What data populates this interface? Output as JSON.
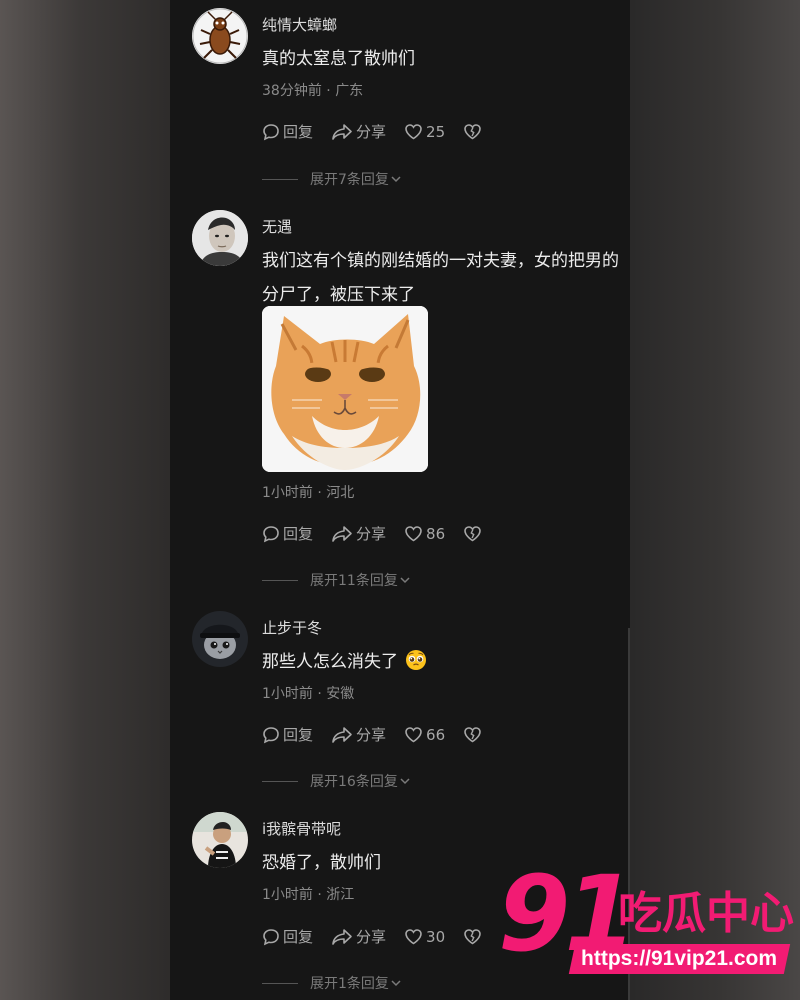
{
  "comments": [
    {
      "username": "纯情大蟑螂",
      "text": "真的太窒息了散帅们",
      "time": "38分钟前",
      "location": "广东",
      "reply": "回复",
      "share": "分享",
      "likes": "25",
      "expand": "展开7条回复"
    },
    {
      "username": "无遇",
      "text": "我们这有个镇的刚结婚的一对夫妻，女的把男的分尸了，被压下来了",
      "time": "1小时前",
      "location": "河北",
      "reply": "回复",
      "share": "分享",
      "likes": "86",
      "expand": "展开11条回复"
    },
    {
      "username": "止步于冬",
      "text": "那些人怎么消失了",
      "time": "1小时前",
      "location": "安徽",
      "reply": "回复",
      "share": "分享",
      "likes": "66",
      "expand": "展开16条回复"
    },
    {
      "username": "i我髌骨带呢",
      "text": "恐婚了，散帅们",
      "time": "1小时前",
      "location": "浙江",
      "reply": "回复",
      "share": "分享",
      "likes": "30",
      "expand": "展开1条回复"
    }
  ],
  "watermark": {
    "number": "91",
    "title": "吃瓜中心",
    "url": "https://91vip21.com"
  },
  "icons": {
    "reply": "speech-bubble-icon",
    "share": "share-arrow-icon",
    "like": "heart-icon",
    "dislike": "broken-heart-icon",
    "emoji": "pleading-face-emoji",
    "expand": "chevron-down-icon"
  },
  "colors": {
    "accent": "#f21b73",
    "panel": "#161616",
    "text": "#ececec",
    "meta": "#8a8a8a"
  }
}
